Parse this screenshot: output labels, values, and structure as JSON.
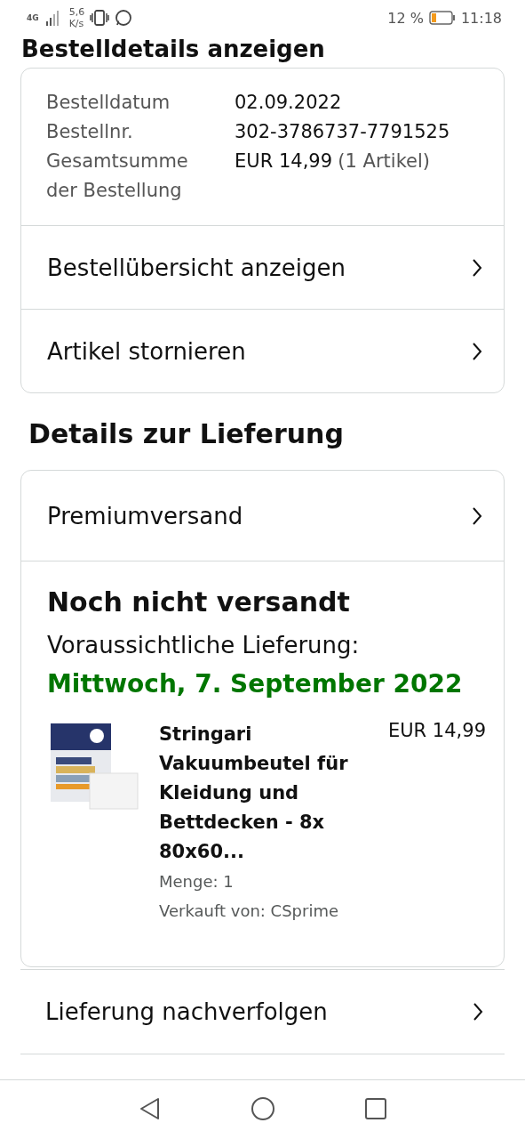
{
  "status_bar": {
    "network": "4G",
    "speed_value": "5,6",
    "speed_unit": "K/s",
    "battery_percent": "12 %",
    "time": "11:18"
  },
  "page_heading": "Bestelldetails anzeigen",
  "order_summary": {
    "fields": [
      {
        "label": "Bestelldatum",
        "value": "02.09.2022"
      },
      {
        "label": "Bestellnr.",
        "value": "302-3786737-7791525"
      },
      {
        "label": "Gesamtsumme der Bestellung",
        "value": "EUR 14,99",
        "note": "(1 Artikel)"
      }
    ],
    "links": [
      "Bestellübersicht anzeigen",
      "Artikel stornieren"
    ]
  },
  "delivery": {
    "heading": "Details zur Lieferung",
    "shipping_link": "Premiumversand",
    "status": "Noch nicht versandt",
    "expected_label": "Voraussichtliche Lieferung:",
    "expected_date": "Mittwoch, 7. September 2022",
    "item": {
      "kind": "picture",
      "title": "Stringari Vakuumbeutel für Kleidung und Bettdecken - 8x 80x60...",
      "price": "EUR 14,99",
      "quantity": "Menge: 1",
      "seller": "Verkauft von: CSprime"
    }
  },
  "track_link": "Lieferung nachverfolgen"
}
